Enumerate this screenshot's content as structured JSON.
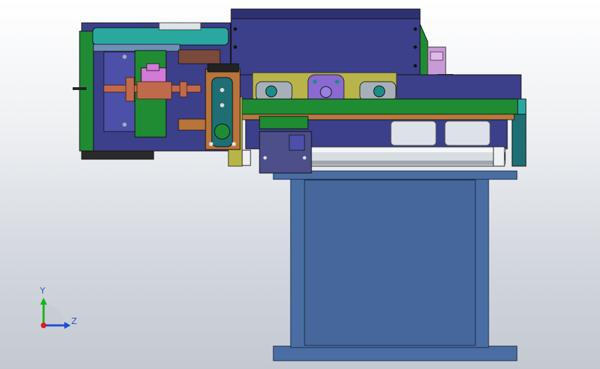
{
  "viewport": {
    "background_top": "#ffffff",
    "background_bottom": "#c4c9d1"
  },
  "triad": {
    "y_label": "Y",
    "z_label": "Z",
    "y_axis_color": "#17b317",
    "z_axis_color": "#1f49d8",
    "origin_color": "#e01b1b"
  },
  "model": {
    "icon": "cad-assembly-model",
    "colors": {
      "stand_blue": "#4a6ea3",
      "housing_navy": "#3c3f8a",
      "accent_green": "#1f8c33",
      "accent_teal": "#2aa8a0",
      "plate_olive": "#b8b44a",
      "part_purple": "#8a6ad0",
      "part_pink": "#d27ad6",
      "shaft_copper": "#c06a4c",
      "roller_silver": "#d8dde2"
    }
  }
}
